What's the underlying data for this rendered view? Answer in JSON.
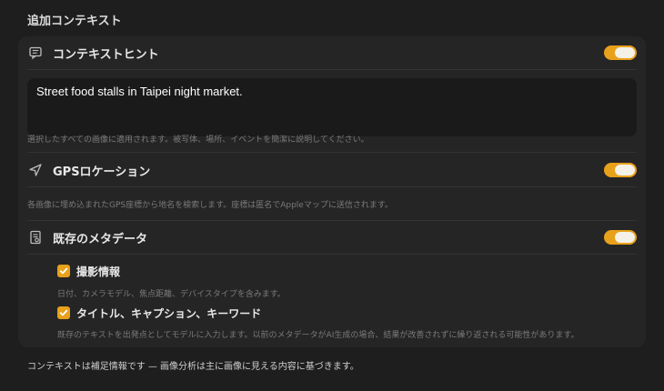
{
  "section": {
    "title": "追加コンテキスト"
  },
  "context_hint": {
    "label": "コンテキストヒント",
    "icon": "message-icon",
    "enabled": true,
    "text": "Street food stalls in Taipei night market.",
    "description": "選択したすべての画像に適用されます。被写体、場所、イベントを簡潔に説明してください。"
  },
  "gps": {
    "label": "GPSロケーション",
    "icon": "location-arrow-icon",
    "enabled": true,
    "description": "各画像に埋め込まれたGPS座標から地名を検索します。座標は匿名でAppleマップに送信されます。"
  },
  "metadata": {
    "label": "既存のメタデータ",
    "icon": "document-icon",
    "enabled": true,
    "options": [
      {
        "label": "撮影情報",
        "checked": true,
        "description": "日付、カメラモデル、焦点距離、デバイスタイプを含みます。"
      },
      {
        "label": "タイトル、キャプション、キーワード",
        "checked": true,
        "description": "既存のテキストを出発点としてモデルに入力します。以前のメタデータがAI生成の場合、結果が改善されずに繰り返される可能性があります。"
      }
    ]
  },
  "footer": {
    "text": "コンテキストは補足情報です — 画像分析は主に画像に見える内容に基づきます。"
  },
  "colors": {
    "accent": "#e8a11a",
    "background": "#1e1e1e",
    "card": "#252525"
  }
}
